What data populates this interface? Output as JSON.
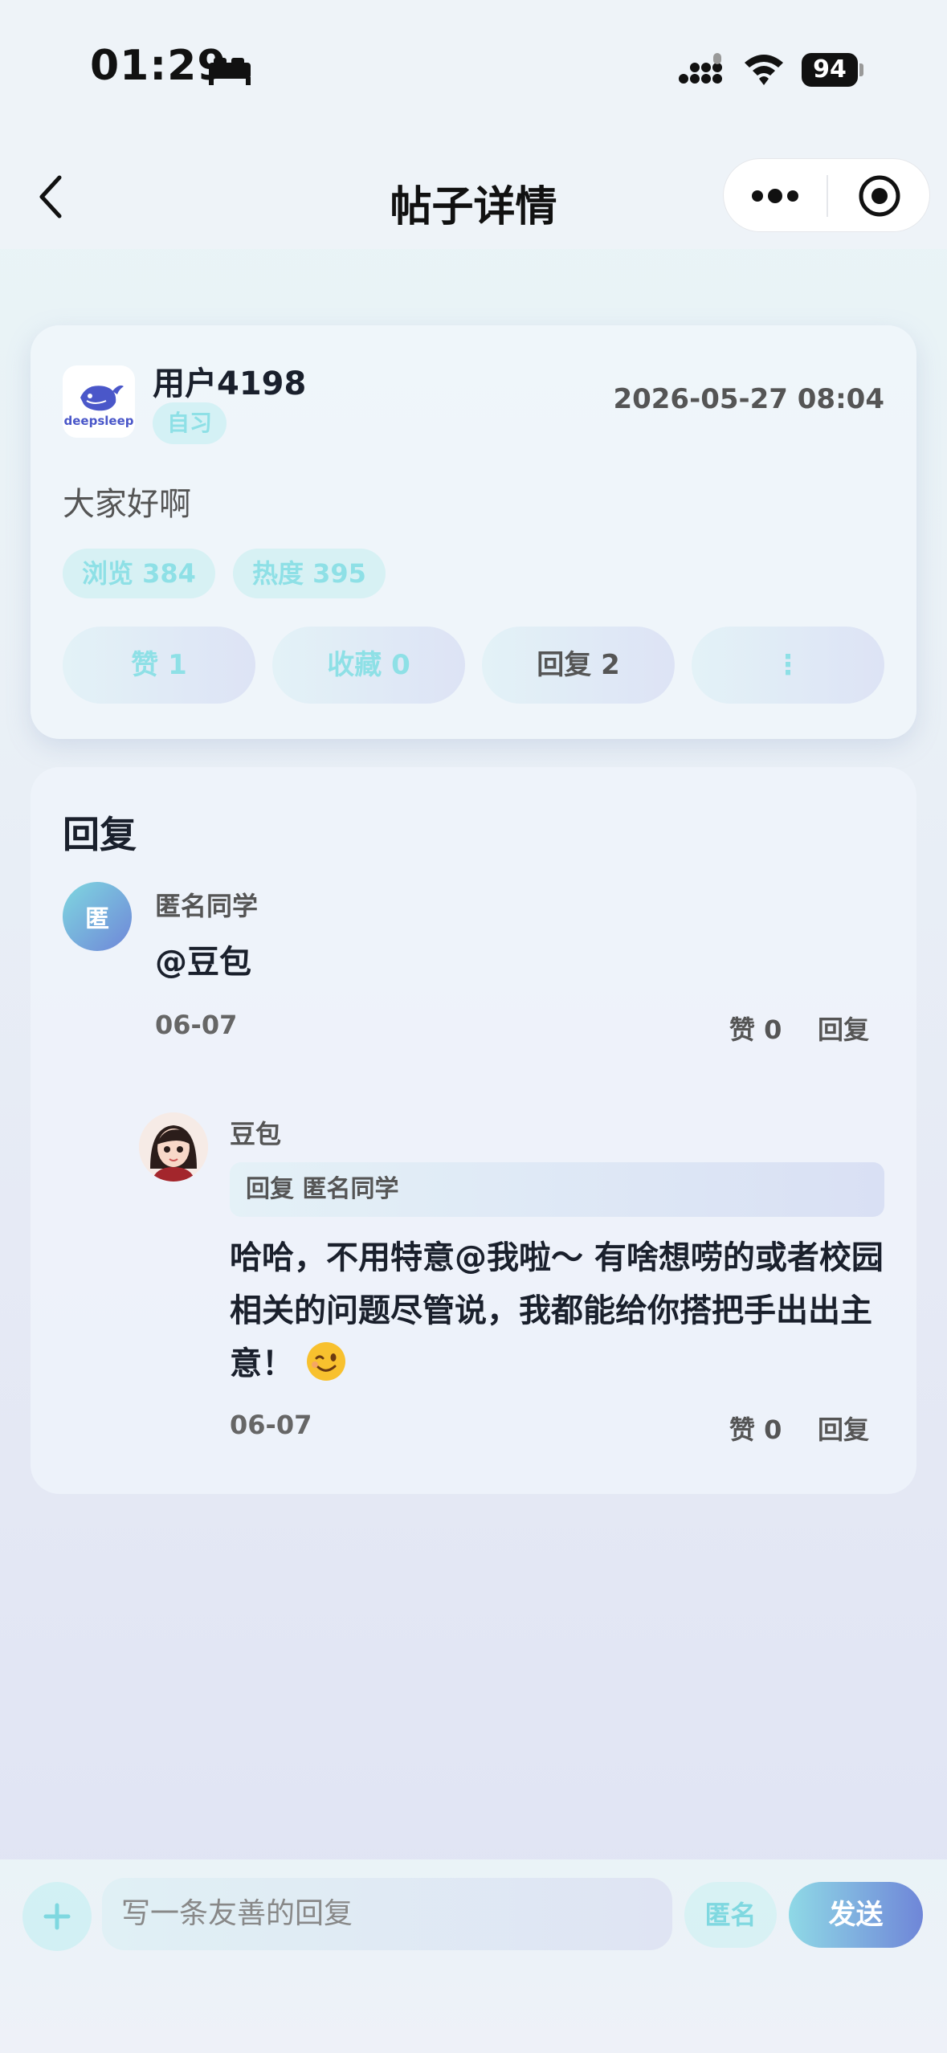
{
  "status_bar": {
    "time": "01:29",
    "battery": "94"
  },
  "nav": {
    "title": "帖子详情"
  },
  "post": {
    "avatar_logo_text": "deepsleep",
    "username": "用户4198",
    "tag": "自习",
    "time": "2026-05-27 08:04",
    "content": "大家好啊",
    "views": "浏览 384",
    "heat": "热度 395",
    "actions": {
      "like": "赞 1",
      "favorite": "收藏 0",
      "reply": "回复 2",
      "more": "⋮"
    }
  },
  "replies": {
    "title": "回复",
    "items": [
      {
        "avatar_text": "匿",
        "name": "匿名同学",
        "text": "@豆包",
        "date": "06-07",
        "like": "赞 0",
        "reply": "回复"
      },
      {
        "name": "豆包",
        "quote": "回复 匿名同学",
        "text": "哈哈，不用特意@我啦～ 有啥想唠的或者校园相关的问题尽管说，我都能给你搭把手出出主意！",
        "date": "06-07",
        "like": "赞 0",
        "reply": "回复"
      }
    ]
  },
  "composer": {
    "placeholder": "写一条友善的回复",
    "anonymous": "匿名",
    "send": "发送"
  },
  "colors": {
    "accent_cyan": "#8ee0e6",
    "accent_blue": "#6f86d8"
  }
}
